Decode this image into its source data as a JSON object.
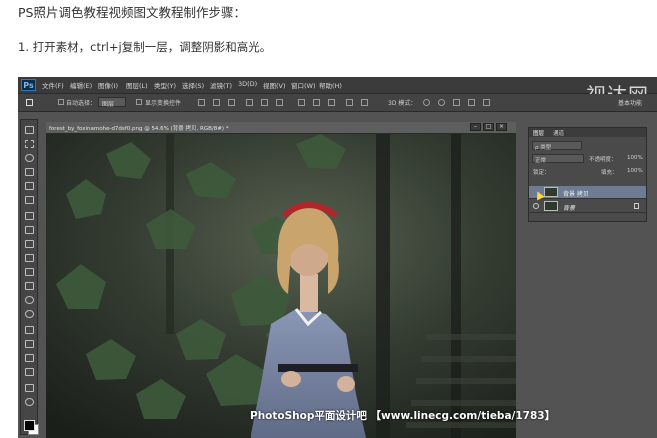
{
  "article": {
    "title": "PS照片调色教程视频图文教程制作步骤：",
    "step1": "1. 打开素材，ctrl+j复制一层，调整阴影和高光。"
  },
  "app": {
    "logo": "Ps",
    "menu": [
      "文件(F)",
      "编辑(E)",
      "图像(I)",
      "图层(L)",
      "类型(Y)",
      "选择(S)",
      "滤镜(T)",
      "3D(D)",
      "视图(V)",
      "窗口(W)",
      "帮助(H)"
    ],
    "workspace": "基本功能",
    "overlay_watermark": "视达网"
  },
  "options": {
    "auto_select": "自动选择：",
    "auto_select_value": "图层",
    "show_transform": "显示变换控件",
    "mode_3d": "3D 模式："
  },
  "document": {
    "tab_title": "forest_by_foxinamohe-d7dsf0.png @ 54.6% (背景 拷贝, RGB/8#) *",
    "watermark": "PhotoShop平面设计吧 【www.linecg.com/tieba/1783】"
  },
  "layers_panel": {
    "tabs": [
      "图层",
      "通道"
    ],
    "filter_kind": "ρ 类型",
    "blend_mode": "正常",
    "opacity_label": "不透明度：",
    "opacity_value": "100%",
    "lock_label": "锁定：",
    "fill_label": "填充：",
    "fill_value": "100%",
    "layers": [
      {
        "name": "背景 拷贝",
        "selected": true
      },
      {
        "name": "背景",
        "selected": false
      }
    ]
  },
  "colors": {
    "menubar": "#3b3b3b",
    "workspace_bg": "#535353",
    "selected_layer": "#6d7c92",
    "ps_blue": "#2b78c2"
  }
}
